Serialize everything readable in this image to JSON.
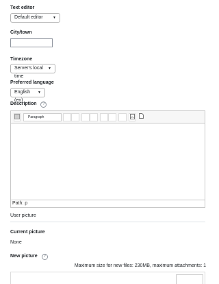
{
  "text_editor": {
    "label": "Text editor",
    "value": "Default editor"
  },
  "city": {
    "label": "City/town",
    "value": ""
  },
  "timezone": {
    "label": "Timezone",
    "value": "Server's local time"
  },
  "language": {
    "label": "Preferred language",
    "value": "English (en)"
  },
  "description": {
    "label": "Description",
    "help": "?",
    "format_value": "Paragraph",
    "status_path": "Path: p"
  },
  "user_picture": {
    "header": "User picture"
  },
  "current_picture": {
    "label": "Current picture",
    "value": "None"
  },
  "new_picture": {
    "label": "New picture",
    "help": "?",
    "max_size": "Maximum size for new files: 230MB, maximum attachments: 1"
  },
  "icons": {
    "dropdown_caret": "▼"
  }
}
